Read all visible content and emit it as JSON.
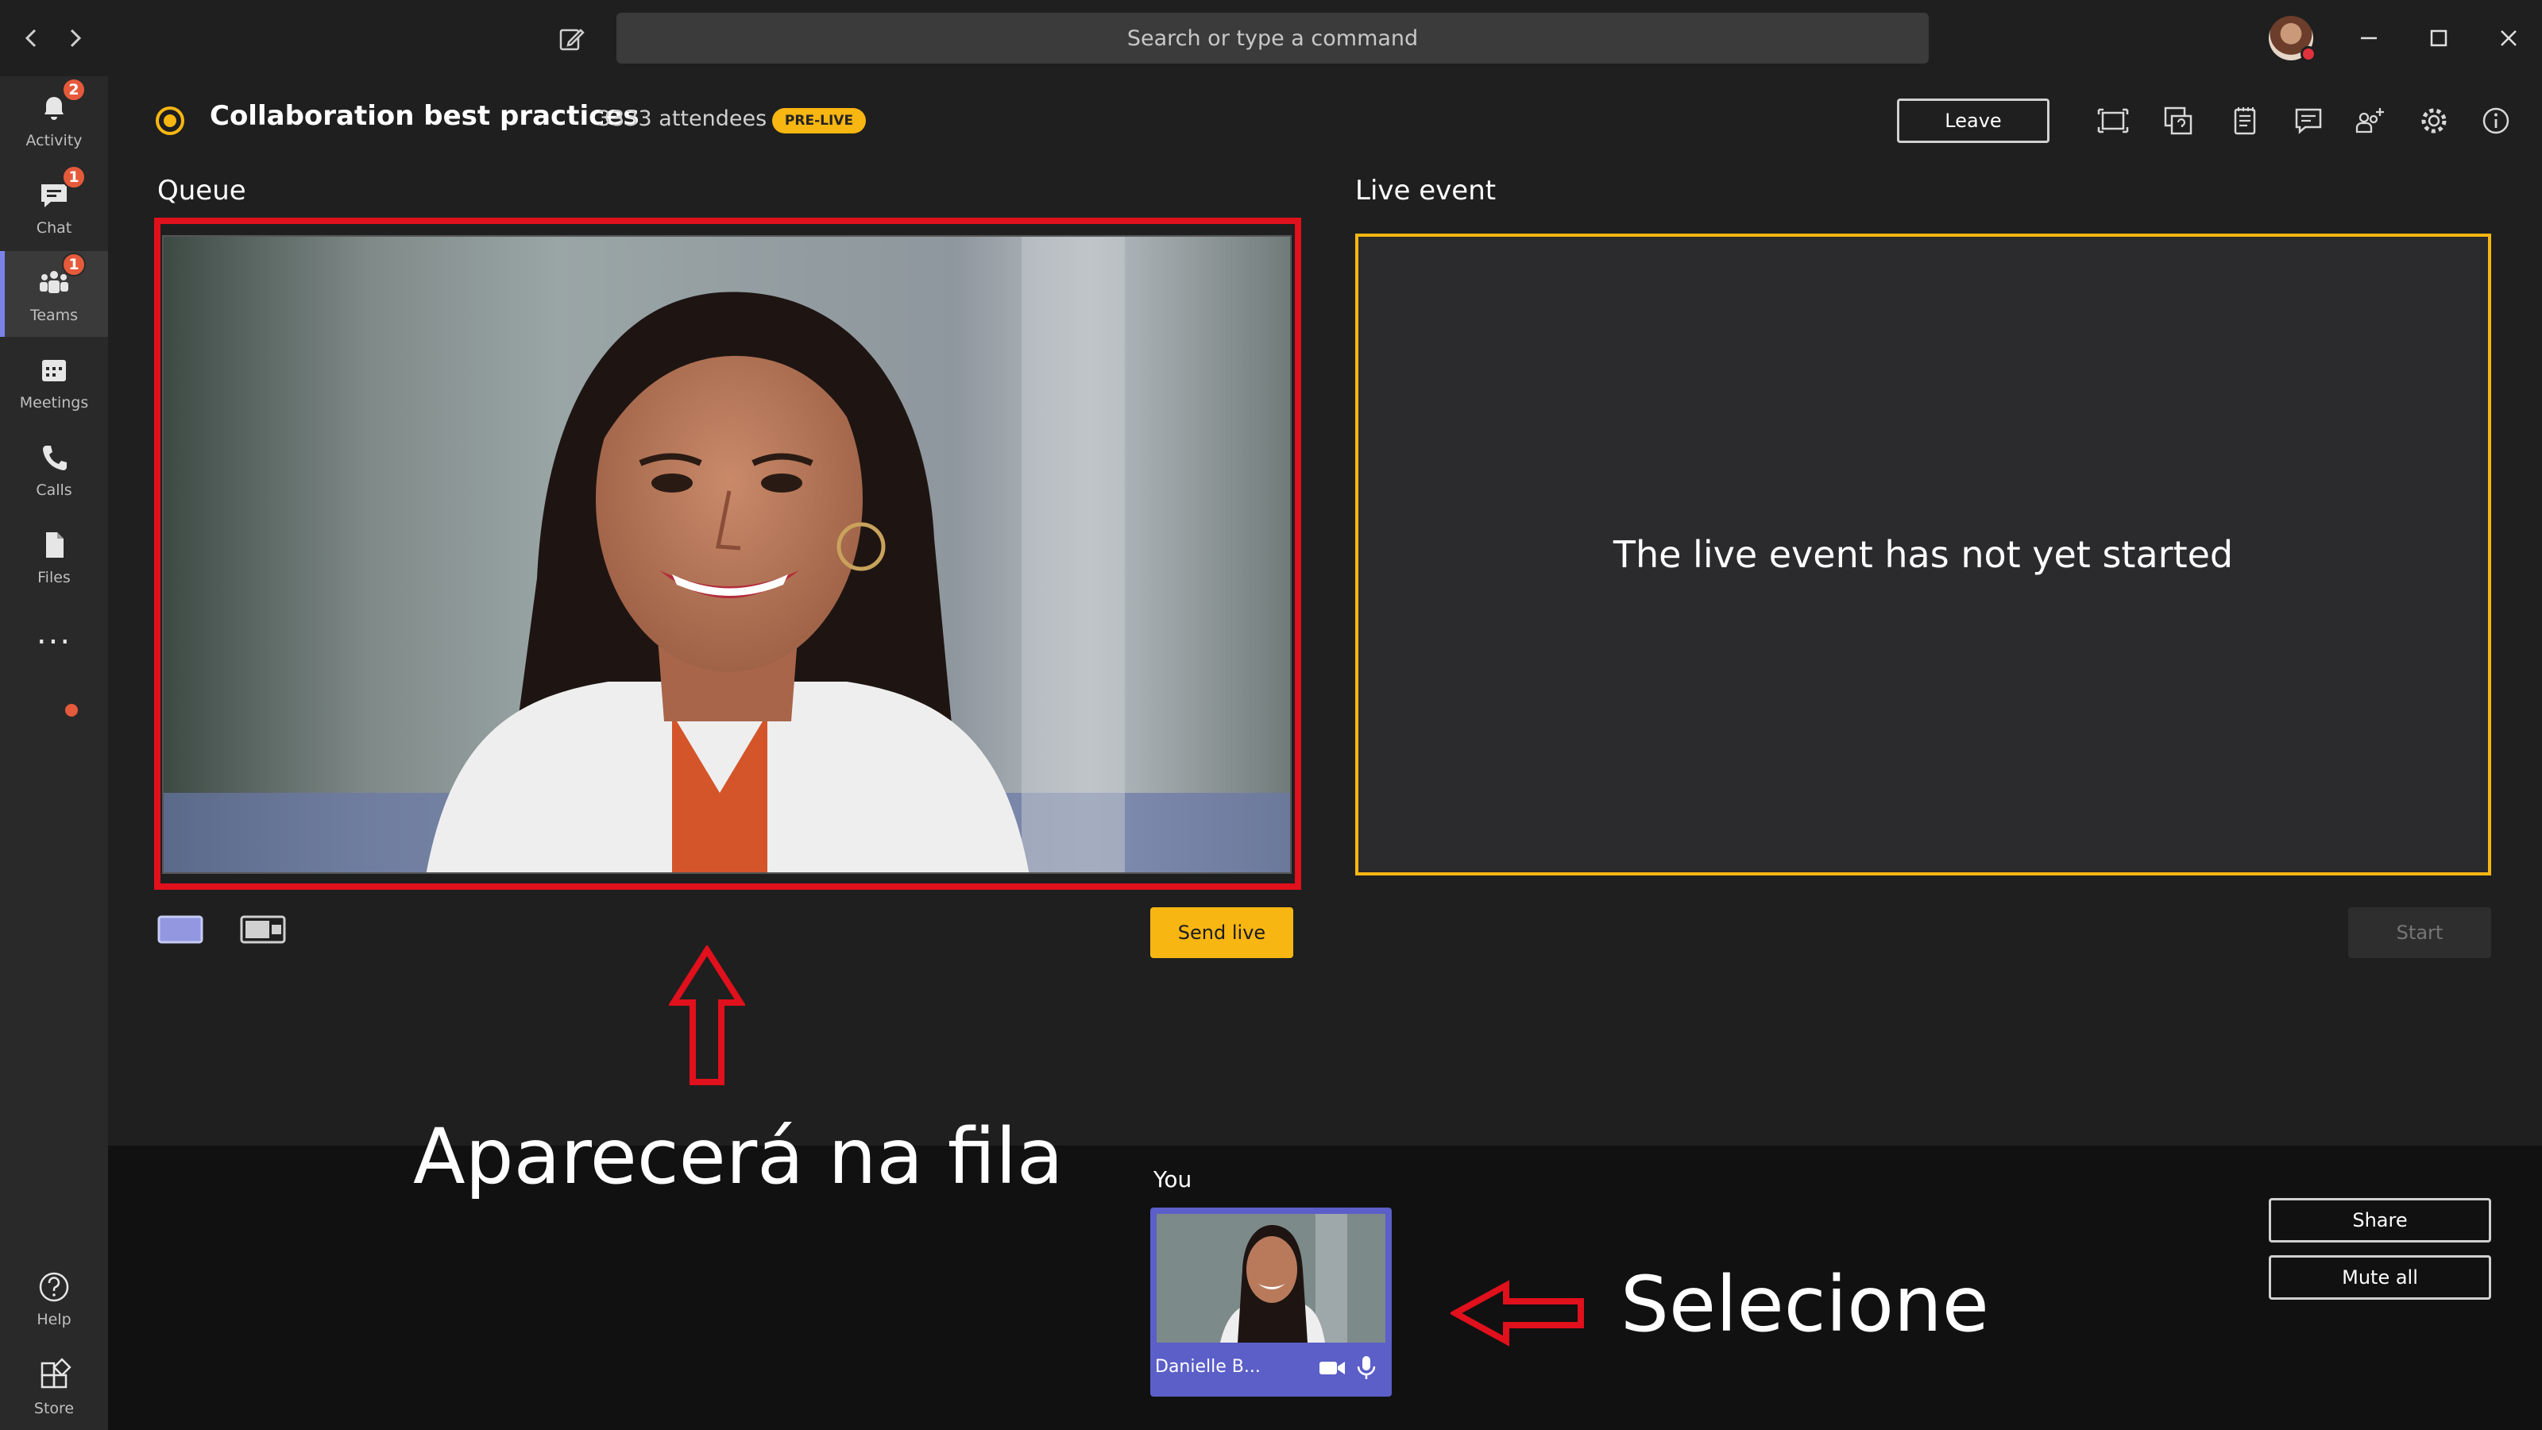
{
  "search": {
    "placeholder": "Search or type a command"
  },
  "rail": {
    "items": [
      {
        "label": "Activity",
        "badge": "2"
      },
      {
        "label": "Chat",
        "badge": "1"
      },
      {
        "label": "Teams",
        "badge": "1"
      },
      {
        "label": "Meetings",
        "badge": ""
      },
      {
        "label": "Calls",
        "badge": ""
      },
      {
        "label": "Files",
        "badge": ""
      }
    ],
    "more": "...",
    "bottom": [
      {
        "label": "Help"
      },
      {
        "label": "Store"
      }
    ]
  },
  "header": {
    "title": "Collaboration best practices",
    "attendees": "3333 attendees",
    "status": "PRE-LIVE",
    "leave": "Leave"
  },
  "queue": {
    "label": "Queue"
  },
  "live": {
    "label": "Live event",
    "message": "The live event has not yet started"
  },
  "controls": {
    "send_live": "Send live",
    "start": "Start"
  },
  "participants": {
    "you_label": "You",
    "name": "Danielle B..."
  },
  "side": {
    "share": "Share",
    "mute_all": "Mute all"
  },
  "annotations": {
    "queue_caption": "Aparecerá na fila",
    "select_caption": "Selecione"
  },
  "colors": {
    "accent": "#f8b612",
    "highlight": "#e0101c",
    "brand": "#5b5fc7"
  }
}
